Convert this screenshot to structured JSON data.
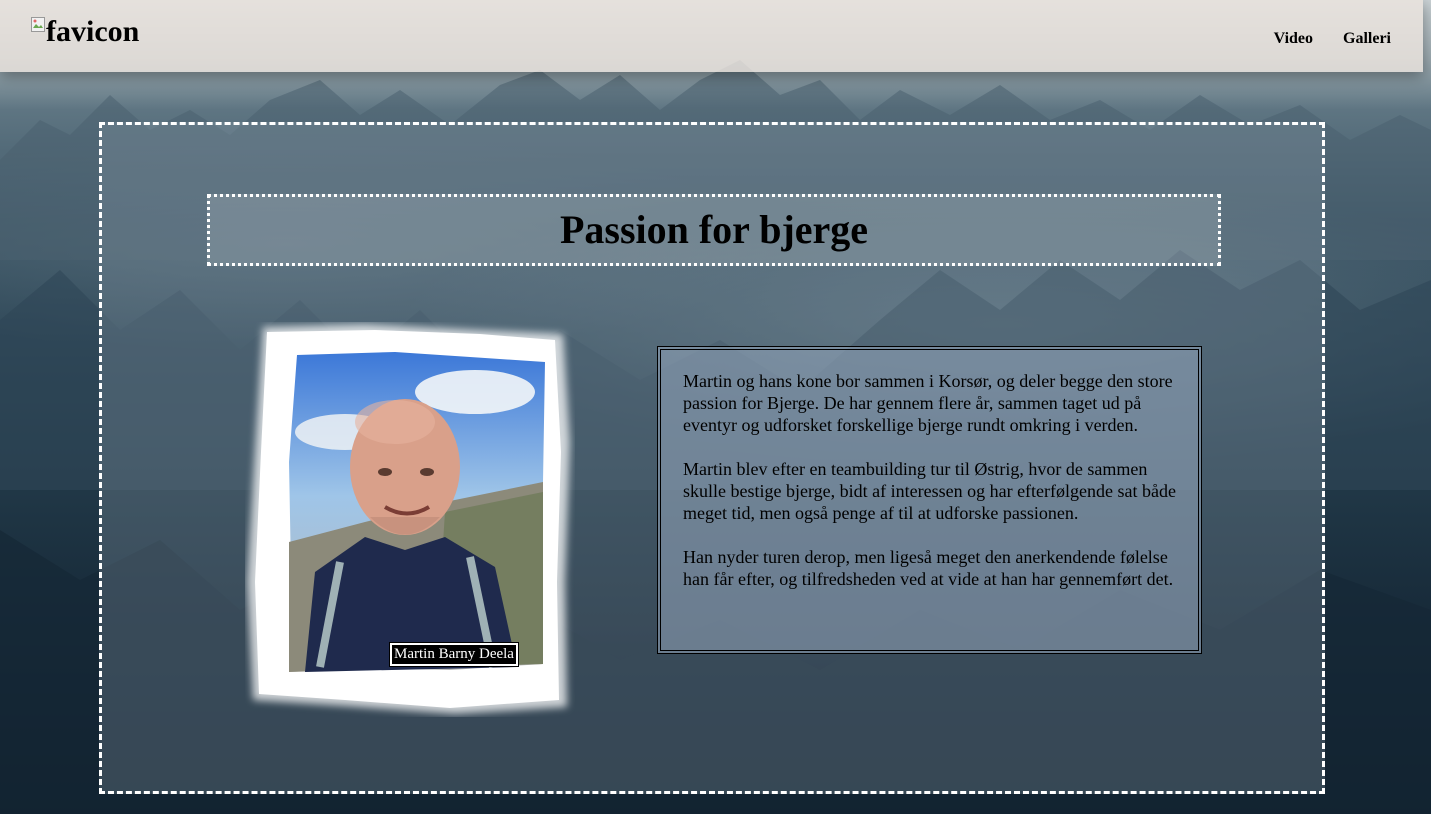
{
  "header": {
    "logo_alt": "favicon",
    "nav": [
      {
        "label": "Video"
      },
      {
        "label": "Galleri"
      }
    ]
  },
  "main": {
    "title": "Passion for bjerge",
    "photo_caption": "Martin Barny Deela",
    "paragraphs": [
      "Martin og hans kone bor sammen i Korsør, og deler begge den store passion for Bjerge. De har gennem flere år, sammen taget ud på eventyr og udforsket forskellige bjerge rundt omkring i verden.",
      "Martin blev efter en teambuilding tur til Østrig, hvor de sammen skulle bestige bjerge, bidt af interessen og har efterfølgende sat både meget tid, men også penge af til at udforske passionen.",
      "Han nyder turen derop, men ligeså meget den anerkendende følelse han får efter, og tilfredsheden ved at vide at han har gennemført det."
    ]
  },
  "colors": {
    "header_bg": "#ebe4de",
    "border": "#ffffff",
    "caption_bg": "#000000"
  }
}
